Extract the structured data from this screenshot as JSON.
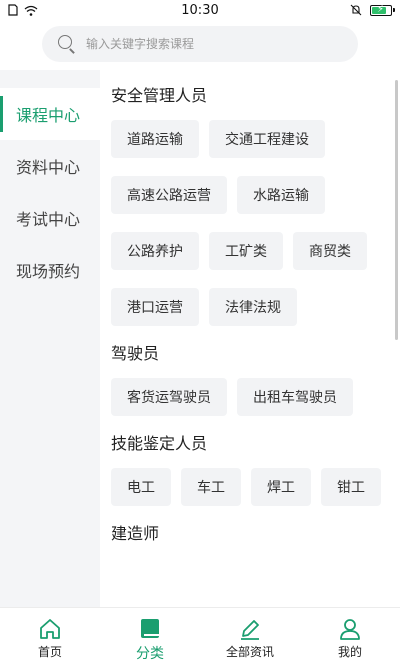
{
  "status_bar": {
    "time": "10:30",
    "battery_level": 0.85
  },
  "search": {
    "placeholder": "输入关键字搜索课程"
  },
  "sidebar": {
    "items": [
      {
        "label": "课程中心",
        "active": true
      },
      {
        "label": "资料中心",
        "active": false
      },
      {
        "label": "考试中心",
        "active": false
      },
      {
        "label": "现场预约",
        "active": false
      }
    ]
  },
  "sections": [
    {
      "title": "安全管理人员",
      "tags": [
        "道路运输",
        "交通工程建设",
        "高速公路运营",
        "水路运输",
        "公路养护",
        "工矿类",
        "商贸类",
        "港口运营",
        "法律法规"
      ]
    },
    {
      "title": "驾驶员",
      "tags": [
        "客货运驾驶员",
        "出租车驾驶员"
      ]
    },
    {
      "title": "技能鉴定人员",
      "tags": [
        "电工",
        "车工",
        "焊工",
        "钳工"
      ]
    },
    {
      "title": "建造师",
      "tags": []
    }
  ],
  "bottom_nav": {
    "items": [
      {
        "label": "首页",
        "icon": "home-icon"
      },
      {
        "label": "分类",
        "icon": "book-icon"
      },
      {
        "label": "全部资讯",
        "icon": "pencil-icon"
      },
      {
        "label": "我的",
        "icon": "user-icon"
      }
    ]
  },
  "colors": {
    "accent": "#1a9e6f",
    "sidebar_bg": "#f4f5f7",
    "tag_bg": "#f2f3f5"
  }
}
